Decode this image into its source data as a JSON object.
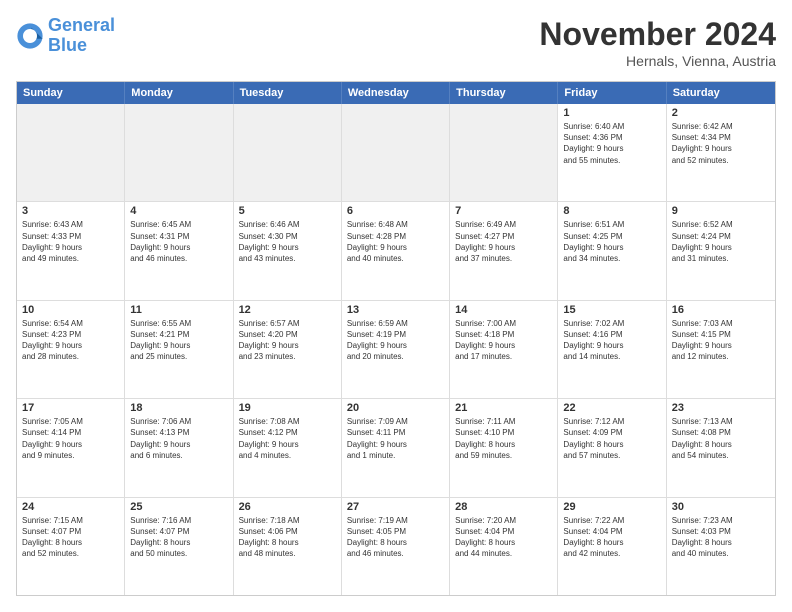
{
  "logo": {
    "line1": "General",
    "line2": "Blue"
  },
  "title": "November 2024",
  "location": "Hernals, Vienna, Austria",
  "header_days": [
    "Sunday",
    "Monday",
    "Tuesday",
    "Wednesday",
    "Thursday",
    "Friday",
    "Saturday"
  ],
  "weeks": [
    [
      {
        "day": "",
        "info": "",
        "empty": true
      },
      {
        "day": "",
        "info": "",
        "empty": true
      },
      {
        "day": "",
        "info": "",
        "empty": true
      },
      {
        "day": "",
        "info": "",
        "empty": true
      },
      {
        "day": "",
        "info": "",
        "empty": true
      },
      {
        "day": "1",
        "info": "Sunrise: 6:40 AM\nSunset: 4:36 PM\nDaylight: 9 hours\nand 55 minutes."
      },
      {
        "day": "2",
        "info": "Sunrise: 6:42 AM\nSunset: 4:34 PM\nDaylight: 9 hours\nand 52 minutes."
      }
    ],
    [
      {
        "day": "3",
        "info": "Sunrise: 6:43 AM\nSunset: 4:33 PM\nDaylight: 9 hours\nand 49 minutes."
      },
      {
        "day": "4",
        "info": "Sunrise: 6:45 AM\nSunset: 4:31 PM\nDaylight: 9 hours\nand 46 minutes."
      },
      {
        "day": "5",
        "info": "Sunrise: 6:46 AM\nSunset: 4:30 PM\nDaylight: 9 hours\nand 43 minutes."
      },
      {
        "day": "6",
        "info": "Sunrise: 6:48 AM\nSunset: 4:28 PM\nDaylight: 9 hours\nand 40 minutes."
      },
      {
        "day": "7",
        "info": "Sunrise: 6:49 AM\nSunset: 4:27 PM\nDaylight: 9 hours\nand 37 minutes."
      },
      {
        "day": "8",
        "info": "Sunrise: 6:51 AM\nSunset: 4:25 PM\nDaylight: 9 hours\nand 34 minutes."
      },
      {
        "day": "9",
        "info": "Sunrise: 6:52 AM\nSunset: 4:24 PM\nDaylight: 9 hours\nand 31 minutes."
      }
    ],
    [
      {
        "day": "10",
        "info": "Sunrise: 6:54 AM\nSunset: 4:23 PM\nDaylight: 9 hours\nand 28 minutes."
      },
      {
        "day": "11",
        "info": "Sunrise: 6:55 AM\nSunset: 4:21 PM\nDaylight: 9 hours\nand 25 minutes."
      },
      {
        "day": "12",
        "info": "Sunrise: 6:57 AM\nSunset: 4:20 PM\nDaylight: 9 hours\nand 23 minutes."
      },
      {
        "day": "13",
        "info": "Sunrise: 6:59 AM\nSunset: 4:19 PM\nDaylight: 9 hours\nand 20 minutes."
      },
      {
        "day": "14",
        "info": "Sunrise: 7:00 AM\nSunset: 4:18 PM\nDaylight: 9 hours\nand 17 minutes."
      },
      {
        "day": "15",
        "info": "Sunrise: 7:02 AM\nSunset: 4:16 PM\nDaylight: 9 hours\nand 14 minutes."
      },
      {
        "day": "16",
        "info": "Sunrise: 7:03 AM\nSunset: 4:15 PM\nDaylight: 9 hours\nand 12 minutes."
      }
    ],
    [
      {
        "day": "17",
        "info": "Sunrise: 7:05 AM\nSunset: 4:14 PM\nDaylight: 9 hours\nand 9 minutes."
      },
      {
        "day": "18",
        "info": "Sunrise: 7:06 AM\nSunset: 4:13 PM\nDaylight: 9 hours\nand 6 minutes."
      },
      {
        "day": "19",
        "info": "Sunrise: 7:08 AM\nSunset: 4:12 PM\nDaylight: 9 hours\nand 4 minutes."
      },
      {
        "day": "20",
        "info": "Sunrise: 7:09 AM\nSunset: 4:11 PM\nDaylight: 9 hours\nand 1 minute."
      },
      {
        "day": "21",
        "info": "Sunrise: 7:11 AM\nSunset: 4:10 PM\nDaylight: 8 hours\nand 59 minutes."
      },
      {
        "day": "22",
        "info": "Sunrise: 7:12 AM\nSunset: 4:09 PM\nDaylight: 8 hours\nand 57 minutes."
      },
      {
        "day": "23",
        "info": "Sunrise: 7:13 AM\nSunset: 4:08 PM\nDaylight: 8 hours\nand 54 minutes."
      }
    ],
    [
      {
        "day": "24",
        "info": "Sunrise: 7:15 AM\nSunset: 4:07 PM\nDaylight: 8 hours\nand 52 minutes."
      },
      {
        "day": "25",
        "info": "Sunrise: 7:16 AM\nSunset: 4:07 PM\nDaylight: 8 hours\nand 50 minutes."
      },
      {
        "day": "26",
        "info": "Sunrise: 7:18 AM\nSunset: 4:06 PM\nDaylight: 8 hours\nand 48 minutes."
      },
      {
        "day": "27",
        "info": "Sunrise: 7:19 AM\nSunset: 4:05 PM\nDaylight: 8 hours\nand 46 minutes."
      },
      {
        "day": "28",
        "info": "Sunrise: 7:20 AM\nSunset: 4:04 PM\nDaylight: 8 hours\nand 44 minutes."
      },
      {
        "day": "29",
        "info": "Sunrise: 7:22 AM\nSunset: 4:04 PM\nDaylight: 8 hours\nand 42 minutes."
      },
      {
        "day": "30",
        "info": "Sunrise: 7:23 AM\nSunset: 4:03 PM\nDaylight: 8 hours\nand 40 minutes."
      }
    ]
  ]
}
